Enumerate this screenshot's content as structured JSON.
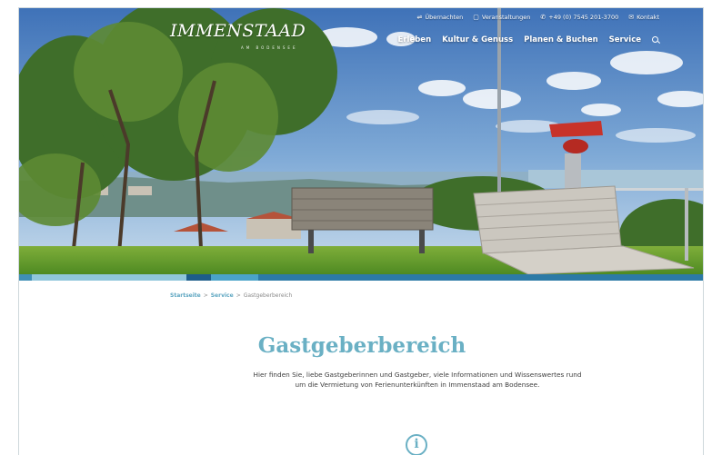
{
  "brand": {
    "logo": "IMMENSTAAD",
    "logo_sub": "AM BODENSEE"
  },
  "topbar": {
    "items": [
      {
        "icon": "bed-icon",
        "glyph": "⇌",
        "label": "Übernachten"
      },
      {
        "icon": "calendar-icon",
        "glyph": "▢",
        "label": "Veranstaltungen"
      },
      {
        "icon": "phone-icon",
        "glyph": "✆",
        "label": "+49 (0) 7545 201-3700"
      },
      {
        "icon": "mail-icon",
        "glyph": "✉",
        "label": "Kontakt"
      }
    ]
  },
  "mainnav": {
    "items": [
      "Erleben",
      "Kultur & Genuss",
      "Planen & Buchen",
      "Service"
    ]
  },
  "stripe_colors": [
    "#3f8fb5",
    "#8fc6db",
    "#1d5d8a",
    "#4aa3c9",
    "#2c7aa6"
  ],
  "breadcrumb": {
    "items": [
      "Startseite",
      "Service",
      "Gastgeberbereich"
    ],
    "separator": ">"
  },
  "main": {
    "title": "Gastgeberbereich",
    "intro": "Hier finden Sie, liebe Gastgeberinnen und Gastgeber, viele Informationen und Wissenswertes rund um die Vermietung von Ferienunterkünften in Immenstaad am Bodensee."
  },
  "colors": {
    "accent": "#6ab0c4",
    "link": "#5fa7c2"
  }
}
